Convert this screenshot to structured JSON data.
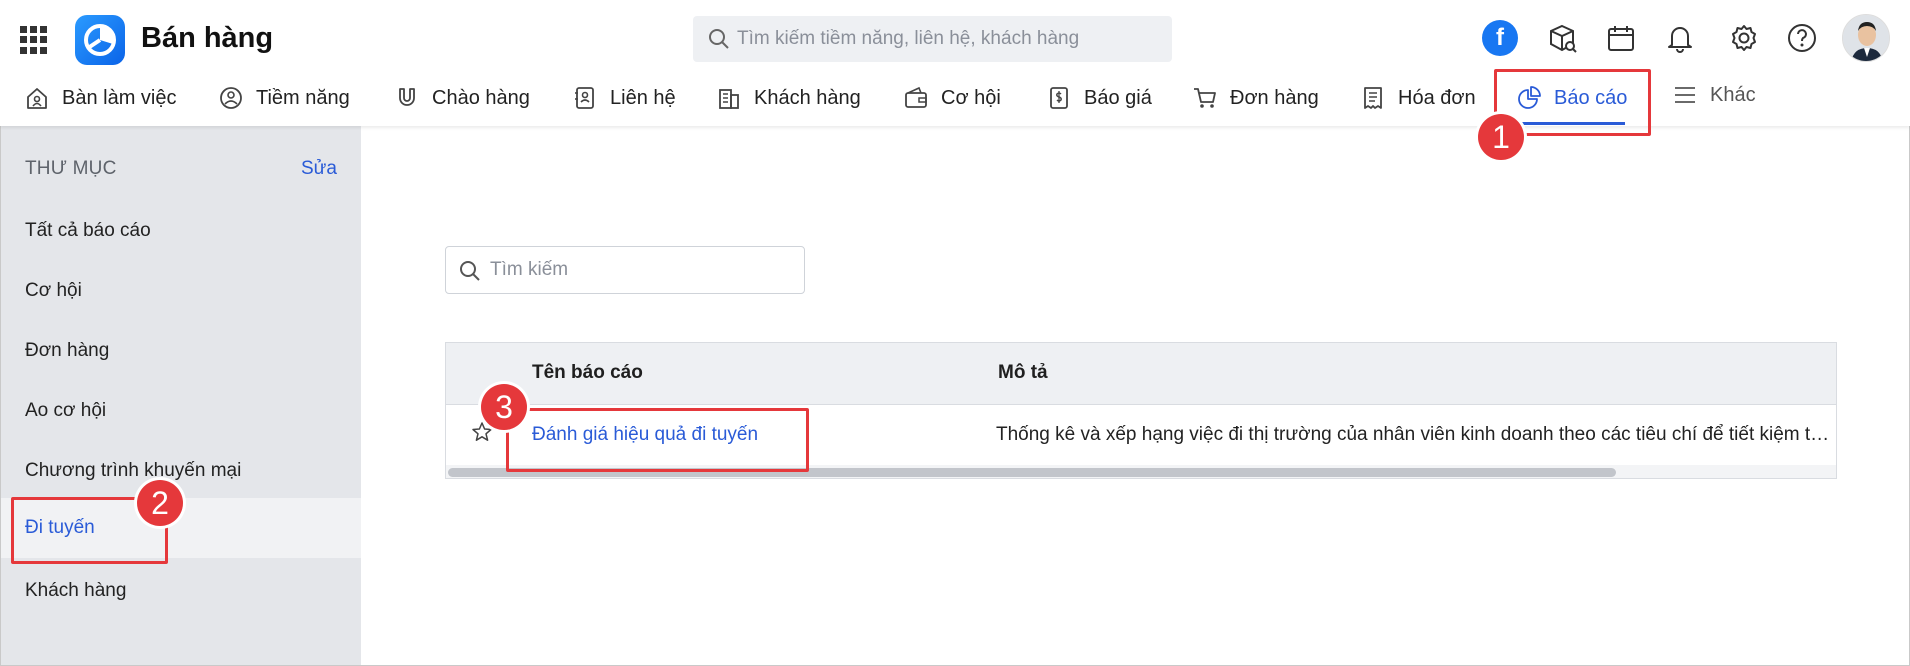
{
  "app": {
    "title": "Bán hàng"
  },
  "header": {
    "search_placeholder": "Tìm kiếm tiềm năng, liên hệ, khách hàng",
    "fb_letter": "f"
  },
  "nav": {
    "items": [
      {
        "label": "Bàn làm việc",
        "icon": "home-icon"
      },
      {
        "label": "Tiềm năng",
        "icon": "user-circle-icon"
      },
      {
        "label": "Chào hàng",
        "icon": "magnet-icon"
      },
      {
        "label": "Liên hệ",
        "icon": "contact-card-icon"
      },
      {
        "label": "Khách hàng",
        "icon": "building-icon"
      },
      {
        "label": "Cơ hội",
        "icon": "wallet-icon"
      },
      {
        "label": "Báo giá",
        "icon": "dollar-document-icon"
      },
      {
        "label": "Đơn hàng",
        "icon": "cart-icon"
      },
      {
        "label": "Hóa đơn",
        "icon": "receipt-icon"
      },
      {
        "label": "Báo cáo",
        "icon": "pie-chart-icon",
        "active": true
      },
      {
        "label": "Khác",
        "icon": "menu-icon"
      }
    ]
  },
  "sidebar": {
    "heading": "THƯ MỤC",
    "edit_label": "Sửa",
    "items": [
      {
        "label": "Tất cả báo cáo"
      },
      {
        "label": "Cơ hội"
      },
      {
        "label": "Đơn hàng"
      },
      {
        "label": "Ao cơ hội"
      },
      {
        "label": "Chương trình khuyến mại"
      },
      {
        "label": "Đi tuyến",
        "active": true
      },
      {
        "label": "Khách hàng"
      }
    ]
  },
  "main": {
    "search_placeholder": "Tìm kiếm",
    "table": {
      "columns": [
        "Tên báo cáo",
        "Mô tả"
      ],
      "rows": [
        {
          "name": "Đánh giá hiệu quả đi tuyến",
          "description": "Thống kê và xếp hạng việc đi thị trường của nhân viên kinh doanh theo các tiêu chí để tiết kiệm th..."
        }
      ]
    }
  },
  "annotations": {
    "step1": "1",
    "step2": "2",
    "step3": "3"
  },
  "colors": {
    "accent": "#2a5bd7",
    "annotation": "#e5383b",
    "sidebar_bg": "#e4e6ea"
  }
}
